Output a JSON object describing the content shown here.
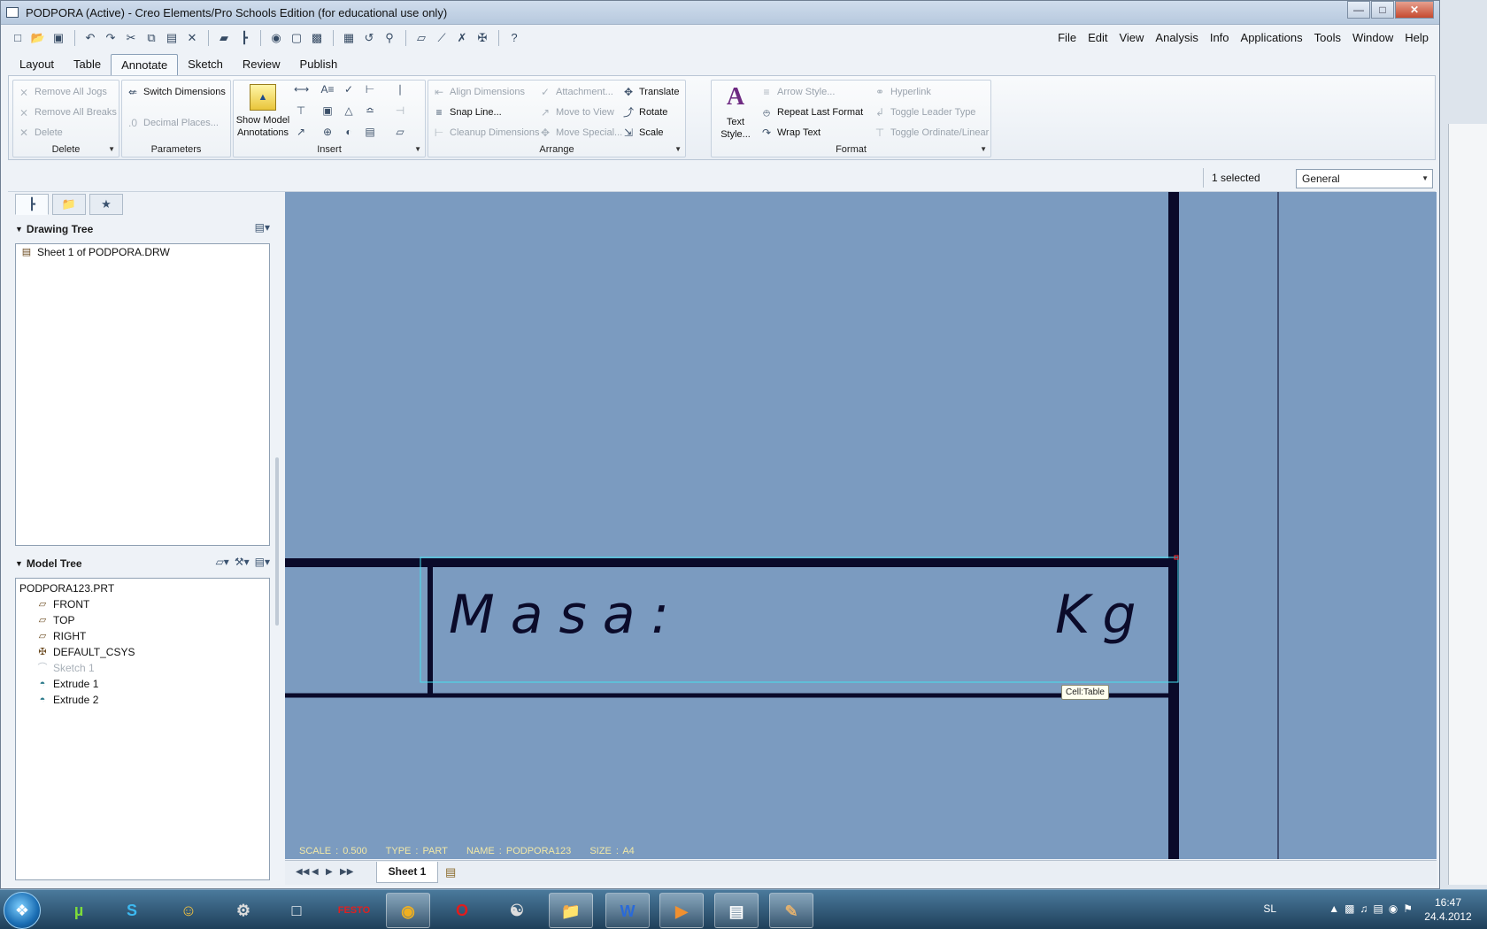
{
  "window": {
    "title": "PODPORA (Active) - Creo Elements/Pro Schools Edition (for educational use only)",
    "buttons": {
      "minimize": "—",
      "maximize": "□",
      "close": "✕"
    }
  },
  "quick_access": {
    "icons": [
      "new-icon",
      "open-icon",
      "save-icon",
      "undo-icon",
      "redo-icon",
      "cut-icon",
      "copy-icon",
      "paste-icon",
      "delete-icon",
      "layer-icon",
      "tree-icon",
      "find-icon",
      "select-box-icon",
      "display-icon",
      "repaint-icon",
      "refit-icon",
      "zoom-icon",
      "show-icon",
      "datum-plane-icon",
      "datum-axis-icon",
      "datum-csys-icon",
      "whats-this-icon"
    ]
  },
  "menu": [
    "File",
    "Edit",
    "View",
    "Analysis",
    "Info",
    "Applications",
    "Tools",
    "Window",
    "Help"
  ],
  "tabs": [
    "Layout",
    "Table",
    "Annotate",
    "Sketch",
    "Review",
    "Publish"
  ],
  "active_tab": "Annotate",
  "ribbon": {
    "delete": {
      "label": "Delete",
      "items": [
        "Remove All Jogs",
        "Remove All Breaks",
        "Delete"
      ]
    },
    "parameters": {
      "label": "Parameters",
      "items": [
        "Switch Dimensions",
        "Decimal Places..."
      ]
    },
    "insert": {
      "label": "Insert",
      "big_button": "Show Model Annotations",
      "big_line1": "Show Model",
      "big_line2": "Annotations"
    },
    "arrange": {
      "label": "Arrange",
      "items": [
        "Align Dimensions",
        "Snap Line...",
        "Cleanup Dimensions",
        "Attachment...",
        "Move to View",
        "Move Special...",
        "Translate",
        "Rotate",
        "Scale"
      ]
    },
    "format": {
      "label": "Format",
      "big_line1": "Text",
      "big_line2": "Style...",
      "items": [
        "Arrow Style...",
        "Repeat Last Format",
        "Wrap Text",
        "Hyperlink",
        "Toggle Leader Type",
        "Toggle Ordinate/Linear"
      ]
    }
  },
  "status": {
    "selected": "1 selected",
    "filter_value": "General"
  },
  "drawing_tree": {
    "title": "Drawing Tree",
    "items": [
      "Sheet 1 of PODPORA.DRW"
    ]
  },
  "model_tree": {
    "title": "Model Tree",
    "root": "PODPORA123.PRT",
    "items": [
      "FRONT",
      "TOP",
      "RIGHT",
      "DEFAULT_CSYS",
      "Sketch 1",
      "Extrude 1",
      "Extrude 2"
    ]
  },
  "canvas": {
    "cell_text_left": "Masa:",
    "cell_text_right": "Kg",
    "tooltip": "Cell:Table",
    "info": {
      "scale": "SCALE : 0.500",
      "type": "TYPE : PART",
      "name": "NAME : PODPORA123",
      "size": "SIZE : A4"
    }
  },
  "sheets": {
    "active": "Sheet 1"
  },
  "taskbar": {
    "lang": "SL",
    "time": "16:47",
    "date": "24.4.2012",
    "apps": [
      "utorrent",
      "skype",
      "game",
      "steam",
      "notepad",
      "festo",
      "chrome",
      "opera",
      "app-icon",
      "explorer",
      "word",
      "media",
      "creo",
      "paint"
    ]
  }
}
